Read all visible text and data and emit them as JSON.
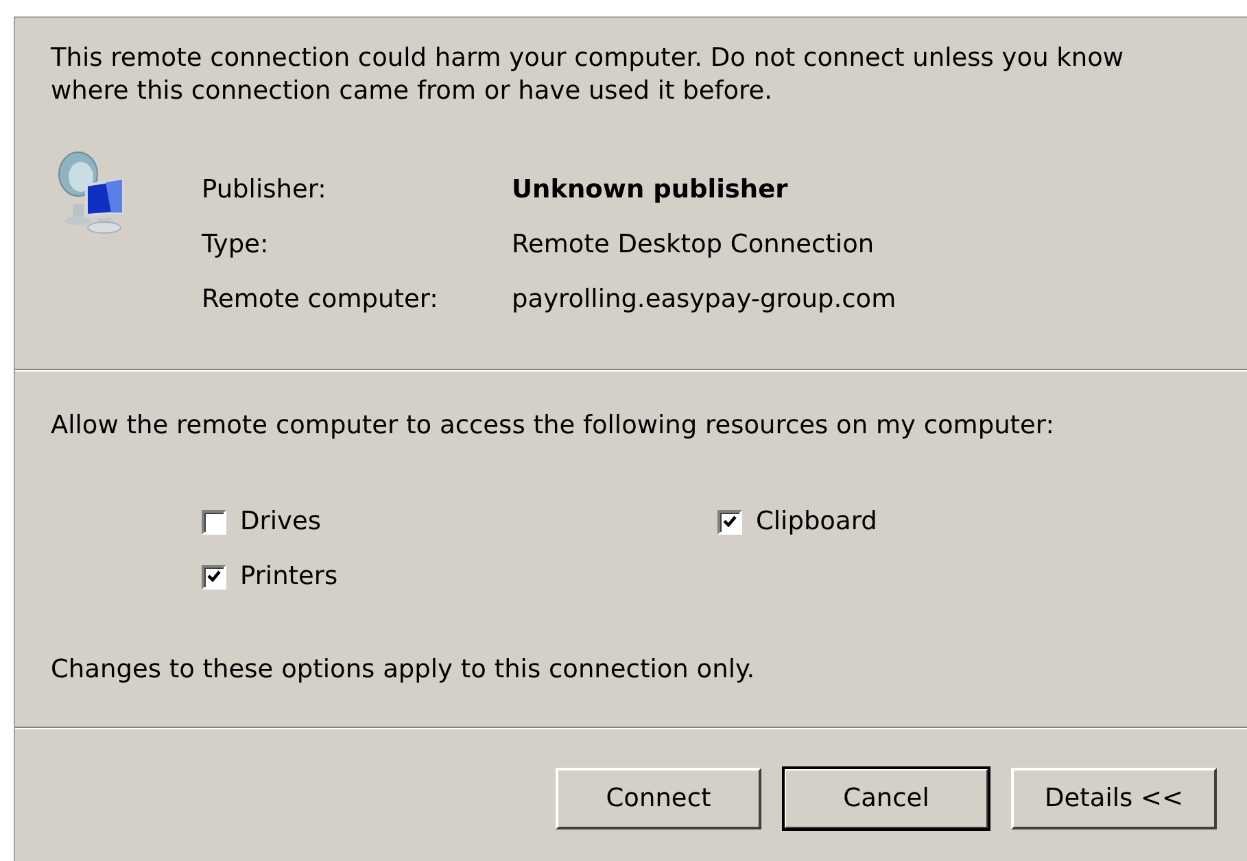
{
  "warning": "This remote connection could harm your computer. Do not connect unless you know where this connection came from or have used it before.",
  "details": [
    {
      "label": "Publisher:",
      "value": "Unknown publisher",
      "bold": true
    },
    {
      "label": "Type:",
      "value": "Remote Desktop Connection",
      "bold": false
    },
    {
      "label": "Remote computer:",
      "value": "payrolling.easypay-group.com",
      "bold": false
    }
  ],
  "resources_prompt": "Allow the remote computer to access the following resources on my computer:",
  "resources": [
    {
      "label": "Drives",
      "checked": false
    },
    {
      "label": "Clipboard",
      "checked": true
    },
    {
      "label": "Printers",
      "checked": true
    }
  ],
  "note": "Changes to these options apply to this connection only.",
  "buttons": [
    {
      "label": "Connect",
      "default": false
    },
    {
      "label": "Cancel",
      "default": true
    },
    {
      "label": "Details <<",
      "default": false
    }
  ]
}
